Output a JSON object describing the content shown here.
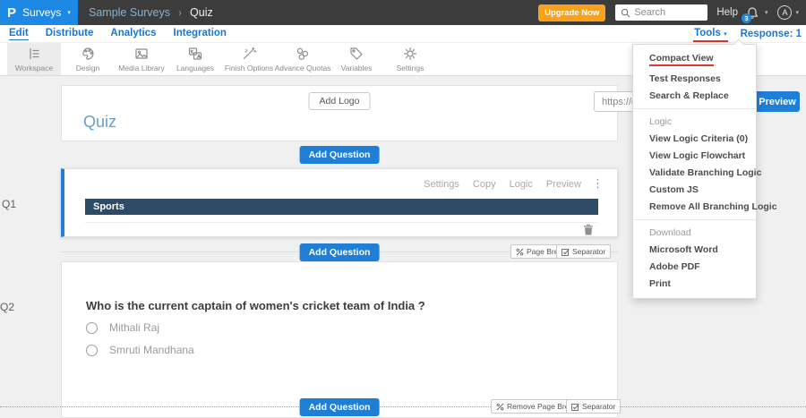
{
  "topbar": {
    "logo_glyph": "P",
    "app_menu_label": "Surveys",
    "breadcrumb_parent": "Sample Surveys",
    "breadcrumb_current": "Quiz",
    "upgrade_label": "Upgrade Now",
    "search_placeholder": "Search",
    "help_label": "Help",
    "notification_count": "3",
    "avatar_initial": "A"
  },
  "nav": {
    "items": [
      {
        "label": "Edit"
      },
      {
        "label": "Distribute"
      },
      {
        "label": "Analytics"
      },
      {
        "label": "Integration"
      }
    ],
    "tools_label": "Tools",
    "response_label": "Response: 1"
  },
  "toolbar": {
    "items": [
      {
        "label": "Workspace"
      },
      {
        "label": "Design"
      },
      {
        "label": "Media Library"
      },
      {
        "label": "Languages"
      },
      {
        "label": "Finish Options"
      },
      {
        "label": "Advance Quotas"
      },
      {
        "label": "Variables"
      },
      {
        "label": "Settings"
      }
    ],
    "url_value": "https://q",
    "preview_label": "Preview"
  },
  "tools_menu": {
    "items": [
      {
        "label": "Compact View"
      },
      {
        "label": "Test Responses"
      },
      {
        "label": "Search & Replace"
      },
      {
        "label": "Logic"
      },
      {
        "label": "View Logic Criteria (0)"
      },
      {
        "label": "View Logic Flowchart"
      },
      {
        "label": "Validate Branching Logic"
      },
      {
        "label": "Custom JS"
      },
      {
        "label": "Remove All Branching Logic"
      },
      {
        "label": "Download"
      },
      {
        "label": "Microsoft Word"
      },
      {
        "label": "Adobe PDF"
      },
      {
        "label": "Print"
      }
    ]
  },
  "survey": {
    "add_logo_label": "Add Logo",
    "title": "Quiz",
    "add_question_label": "Add Question",
    "page_break_label": "Page Break",
    "remove_page_break_label": "Remove Page Break",
    "separator_label": "Separator",
    "q1": {
      "number": "Q1",
      "actions": [
        {
          "label": "Settings"
        },
        {
          "label": "Copy"
        },
        {
          "label": "Logic"
        },
        {
          "label": "Preview"
        }
      ],
      "section_title": "Sports"
    },
    "q2": {
      "number": "Q2",
      "question": "Who is the current captain of women's cricket team of India ?",
      "options": [
        {
          "label": "Mithali Raj"
        },
        {
          "label": "Smruti Mandhana"
        }
      ]
    }
  },
  "colors": {
    "accent_blue": "#1f7ed6",
    "logo_blue": "#1e88e5",
    "upgrade_orange": "#f9a11b",
    "section_navy": "#2e4b66",
    "highlight_red": "#d8392e",
    "topbar_gray": "#3c3c3c"
  }
}
